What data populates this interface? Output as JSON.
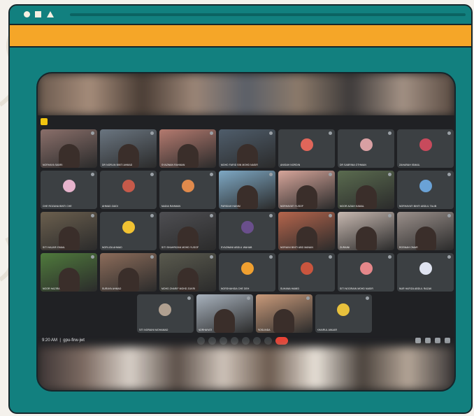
{
  "meeting": {
    "time": "9:20 AM",
    "meeting_code": "gpu-firw-jwt"
  },
  "participants": [
    {
      "name": "NORHAYA SABRI",
      "kind": "photo",
      "color": "#8a6f6a"
    },
    {
      "name": "DR NORLIN BINTI AHMAD",
      "kind": "photo",
      "color": "#6a7580"
    },
    {
      "name": "SYAZWAN RAHMAN",
      "kind": "photo",
      "color": "#b47a6f"
    },
    {
      "name": "MOHD FARID BIN MOHD NASIR",
      "kind": "photo",
      "color": "#4f5d6b"
    },
    {
      "name": "ANISAH NORDIN",
      "kind": "avatar",
      "color": "#e0665a"
    },
    {
      "name": "DR SABRINA OTHMAN",
      "kind": "avatar",
      "color": "#d9a0a3"
    },
    {
      "name": "ZAHARAH ISMAIL",
      "kind": "avatar",
      "color": "#c84a5c"
    },
    {
      "name": "CHE ROZANA BINTI CHE",
      "kind": "avatar",
      "color": "#e6b3cc"
    },
    {
      "name": "AHMAD ZAIDI",
      "kind": "avatar",
      "color": "#c65a4a"
    },
    {
      "name": "NADIA RAHMAN",
      "kind": "avatar",
      "color": "#e08a4c"
    },
    {
      "name": "FARIDAH HANIM",
      "kind": "photo",
      "color": "#7ea8c4"
    },
    {
      "name": "NORHAYATI YUSOF",
      "kind": "photo",
      "color": "#d6a59a"
    },
    {
      "name": "NOOR AZIAH KAMAL",
      "kind": "photo",
      "color": "#5a6b4f"
    },
    {
      "name": "NORHAYATI BINTI ABDUL TALIB",
      "kind": "avatar",
      "color": "#6aa2d6"
    },
    {
      "name": "SITI HAJAR ISMAIL",
      "kind": "photo",
      "color": "#6b5f4e"
    },
    {
      "name": "NORLIZA AHMAD",
      "kind": "avatar",
      "color": "#f1c232"
    },
    {
      "name": "SITI SHAHRIZAN MOHD YUSOF",
      "kind": "photo",
      "color": "#4e4e52"
    },
    {
      "name": "SYAZWANI ABDUL WAHAB",
      "kind": "avatar",
      "color": "#6a4f8c"
    },
    {
      "name": "NORAINI BINTI ABD MANAN",
      "kind": "photo",
      "color": "#b5654c"
    },
    {
      "name": "ZURAINI",
      "kind": "photo",
      "color": "#c7b8b0"
    },
    {
      "name": "ROSNAH OMAR",
      "kind": "photo",
      "color": "#9a8f8a"
    },
    {
      "name": "NOOR HAZIRA",
      "kind": "photo",
      "color": "#4f7a3c"
    },
    {
      "name": "SURAYA AHMAD",
      "kind": "photo",
      "color": "#8c6c5a"
    },
    {
      "name": "MOHD ZHARIF MOHD ZUKRI",
      "kind": "photo",
      "color": "#5a5a4e"
    },
    {
      "name": "NORSHAHIDA CHE DEH",
      "kind": "avatar",
      "color": "#f0a030"
    },
    {
      "name": "SUHANA HAMID",
      "kind": "avatar",
      "color": "#c9553e"
    },
    {
      "name": "SITI NOORAIN MOHD NASIR",
      "kind": "avatar",
      "color": "#e5878a"
    },
    {
      "name": "NUR HAFIZA ABDUL RAZAK",
      "kind": "avatar",
      "color": "#dfe3f0"
    },
    {
      "name": "SITI NORAINI MOHAMAD",
      "kind": "avatar",
      "color": "#b0a090"
    },
    {
      "name": "NORHAYATI",
      "kind": "photo",
      "color": "#a8b2bd"
    },
    {
      "name": "ROSLINDA",
      "kind": "photo",
      "color": "#c99a7a"
    },
    {
      "name": "KHAIRUL ANUAR",
      "kind": "avatar",
      "color": "#e8c13c"
    }
  ]
}
